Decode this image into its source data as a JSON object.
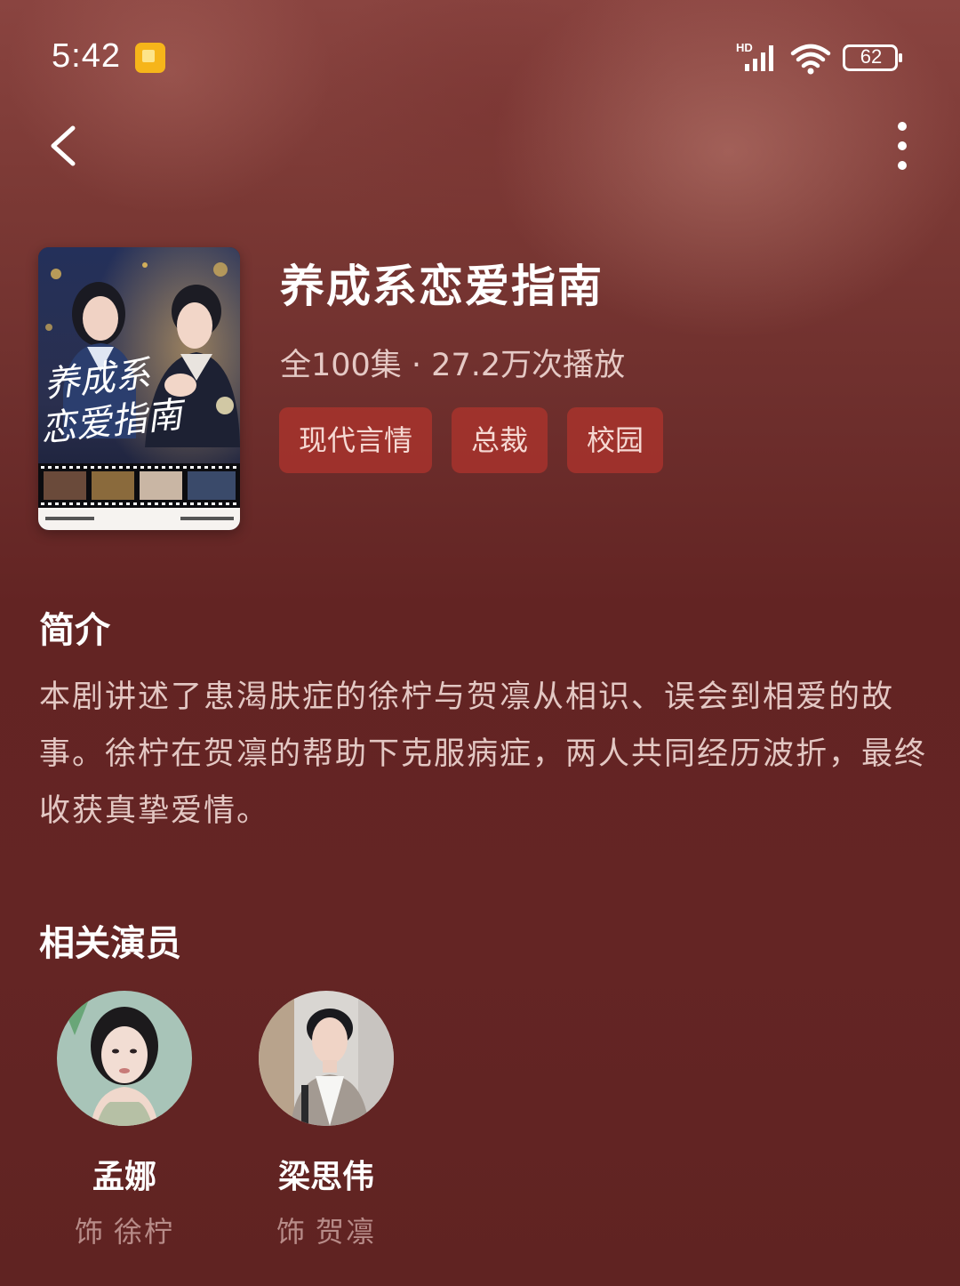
{
  "status_bar": {
    "time": "5:42",
    "network": "HD",
    "battery": "62"
  },
  "nav": {
    "back_icon": "chevron-left-icon",
    "more_icon": "more-vertical-icon"
  },
  "poster": {
    "calligraphy_line1": "养成系",
    "calligraphy_line2": "恋爱指南"
  },
  "drama": {
    "title": "养成系恋爱指南",
    "meta": "全100集 · 27.2万次播放",
    "tags": [
      "现代言情",
      "总裁",
      "校园"
    ]
  },
  "intro": {
    "heading": "简介",
    "text": "本剧讲述了患渴肤症的徐柠与贺凛从相识、误会到相爱的故事。徐柠在贺凛的帮助下克服病症，两人共同经历波折，最终收获真挚爱情。"
  },
  "actors": {
    "heading": "相关演员",
    "items": [
      {
        "name": "孟娜",
        "role_prefix": "饰",
        "role": "徐柠"
      },
      {
        "name": "梁思伟",
        "role_prefix": "饰",
        "role": "贺凛"
      }
    ]
  },
  "colors": {
    "background": "#632423",
    "tag_bg": "#b53a32",
    "text_primary": "#ffffff"
  }
}
